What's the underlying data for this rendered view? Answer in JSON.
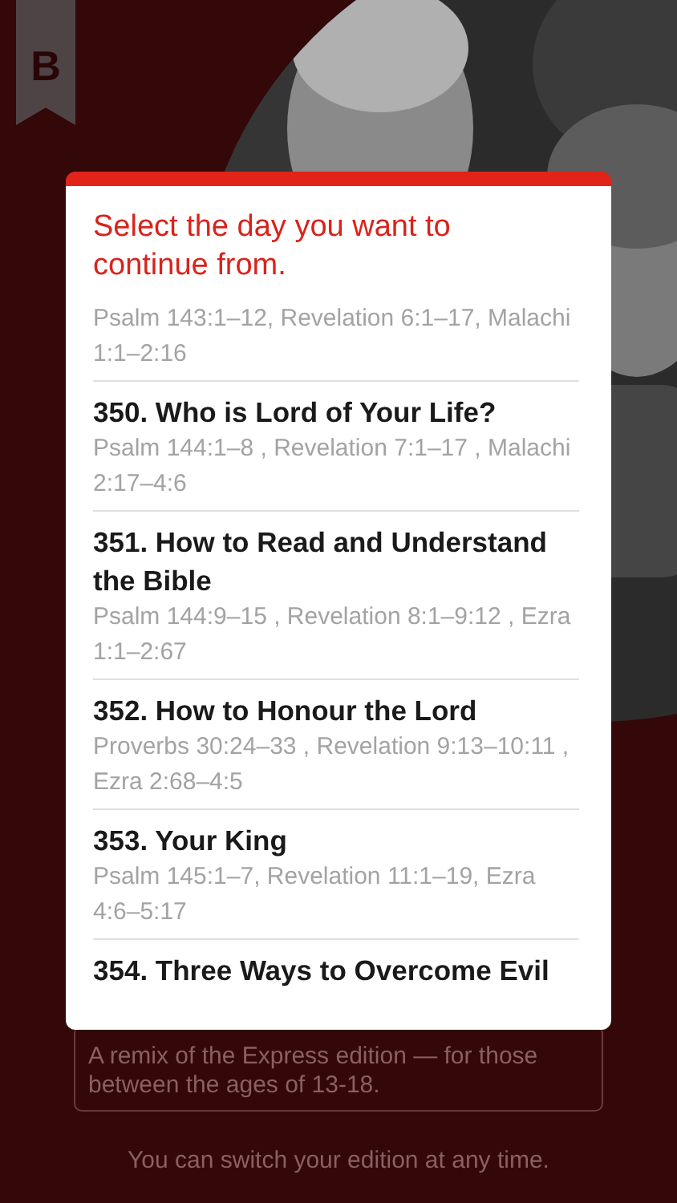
{
  "logo": {
    "letter": "B"
  },
  "background": {
    "edition_card": {
      "description": "A remix of the Express edition — for those between the ages of 13-18."
    },
    "note": "You can switch your edition at any time."
  },
  "dialog": {
    "title": "Select the day you want to continue from.",
    "days": [
      {
        "passages": "Psalm 143:1–12, Revelation 6:1–17, Malachi 1:1–2:16"
      },
      {
        "title": "350. Who is Lord of Your Life?",
        "passages": "Psalm 144:1–8 , Revelation 7:1–17 , Malachi 2:17–4:6"
      },
      {
        "title": "351. How to Read and Understand the Bible",
        "passages": "Psalm 144:9–15 , Revelation 8:1–9:12 , Ezra 1:1–2:67"
      },
      {
        "title": "352. How to Honour the Lord",
        "passages": "Proverbs 30:24–33 , Revelation 9:13–10:11 , Ezra 2:68–4:5"
      },
      {
        "title": "353. Your King",
        "passages": "Psalm 145:1–7, Revelation 11:1–19, Ezra 4:6–5:17"
      },
      {
        "title": "354. Three Ways to Overcome Evil"
      }
    ]
  }
}
